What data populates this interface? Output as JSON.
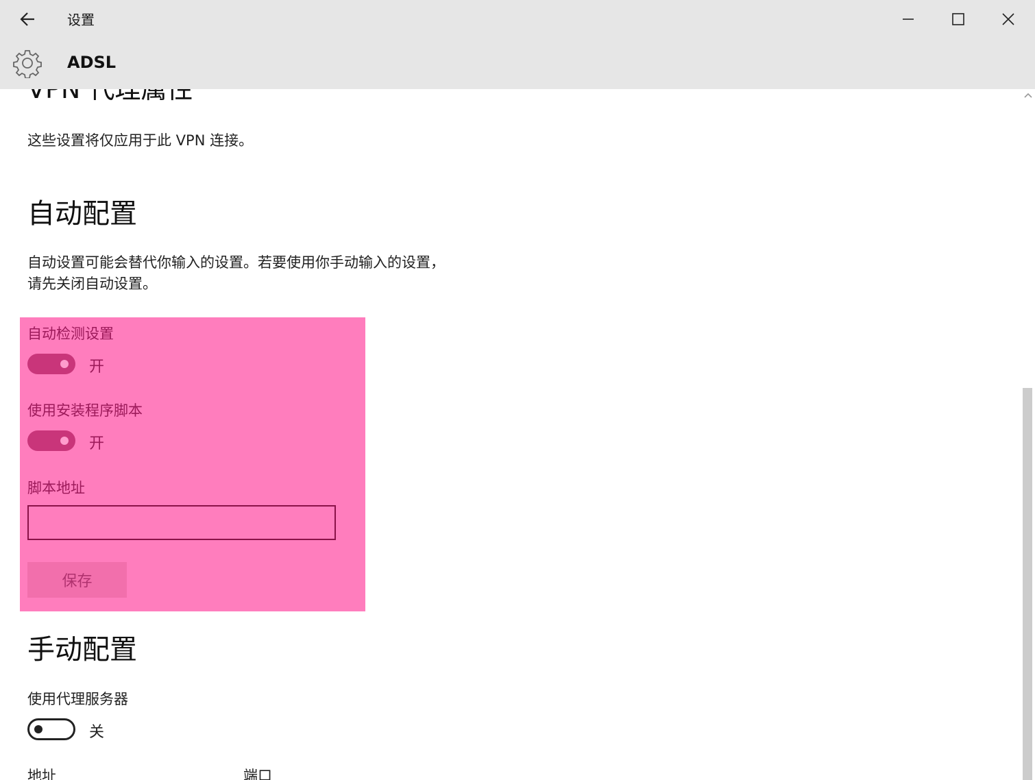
{
  "window": {
    "app_title": "设置",
    "page_header": "ADSL"
  },
  "icons": {
    "back": "back-arrow-icon",
    "minimize": "minimize-icon",
    "maximize": "maximize-icon",
    "close": "close-icon",
    "settings": "gear-icon",
    "scroll_up": "chevron-up-icon"
  },
  "content": {
    "section_title": "VPN 代理属性",
    "section_desc": "这些设置将仅应用于此 VPN 连接。",
    "auto": {
      "heading": "自动配置",
      "desc_line1": "自动设置可能会替代你输入的设置。若要使用你手动输入的设置，",
      "desc_line2": "请先关闭自动设置。",
      "detect_label": "自动检测设置",
      "detect_state": "开",
      "script_label": "使用安装程序脚本",
      "script_state": "开",
      "address_label": "脚本地址",
      "address_value": "",
      "save_label": "保存"
    },
    "manual": {
      "heading": "手动配置",
      "proxy_label": "使用代理服务器",
      "proxy_state": "关",
      "address_label": "地址",
      "port_label": "端口"
    }
  },
  "colors": {
    "titlebar_bg": "#e6e6e6",
    "highlight": "#ff7dbd",
    "toggle_on": "#c9357a",
    "label_highlight": "#9c1a5a"
  }
}
